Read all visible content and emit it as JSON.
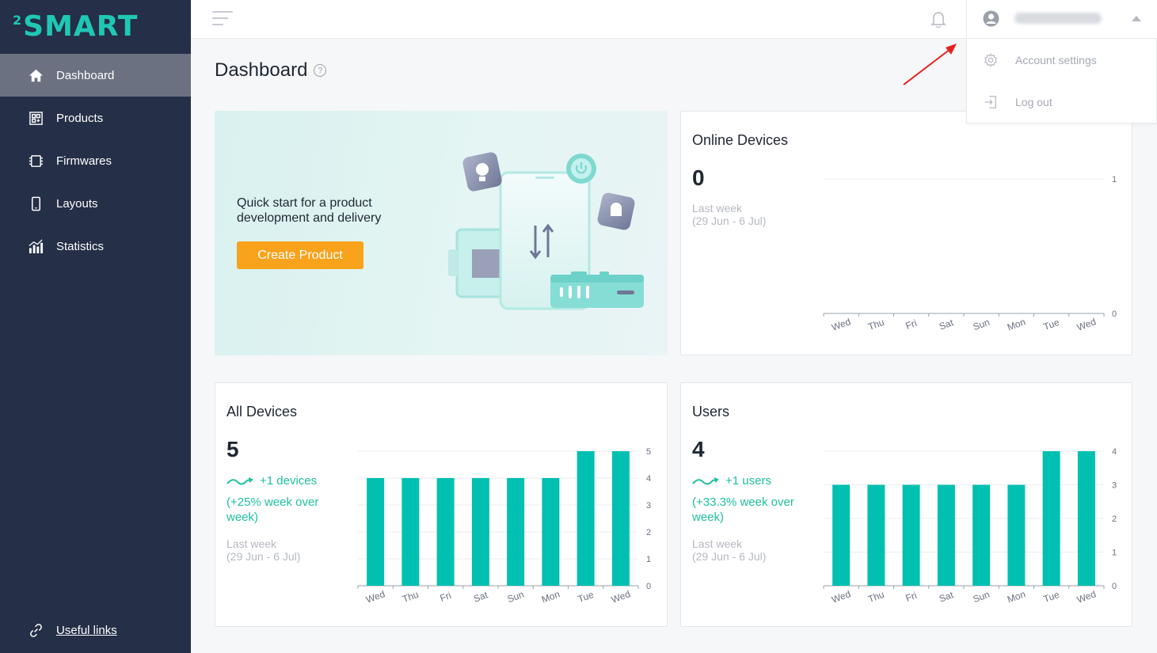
{
  "logo": {
    "sup": "2",
    "name": "SMART"
  },
  "sidebar": {
    "items": [
      {
        "label": "Dashboard",
        "icon": "home-icon",
        "active": true
      },
      {
        "label": "Products",
        "icon": "products-icon",
        "active": false
      },
      {
        "label": "Firmwares",
        "icon": "chip-icon",
        "active": false
      },
      {
        "label": "Layouts",
        "icon": "phone-icon",
        "active": false
      },
      {
        "label": "Statistics",
        "icon": "statistics-icon",
        "active": false
      }
    ],
    "useful_links": "Useful links"
  },
  "account_menu": {
    "items": [
      {
        "label": "Account settings",
        "icon": "gear-icon"
      },
      {
        "label": "Log out",
        "icon": "logout-icon"
      }
    ]
  },
  "page": {
    "title": "Dashboard",
    "help": "?"
  },
  "promo": {
    "text_line1": "Quick start for a product",
    "text_line2": "development and delivery",
    "button": "Create Product"
  },
  "cards": {
    "online": {
      "title": "Online Devices",
      "value": "0",
      "last_week": "Last week",
      "range": "(29 Jun - 6 Jul)"
    },
    "all": {
      "title": "All Devices",
      "value": "5",
      "trend": "+1 devices",
      "trend_detail_1": "(+25% week over",
      "trend_detail_2": "week)",
      "last_week": "Last week",
      "range": "(29 Jun - 6 Jul)"
    },
    "users": {
      "title": "Users",
      "value": "4",
      "trend": "+1 users",
      "trend_detail_1": "(+33.3% week over",
      "trend_detail_2": "week)",
      "last_week": "Last week",
      "range": "(29 Jun - 6 Jul)"
    }
  },
  "colors": {
    "accent": "#1fc8b4",
    "bar": "#00c0b1",
    "sidebar": "#252f47",
    "button": "#f9a21b",
    "trend": "#1fc0a0"
  },
  "chart_data": [
    {
      "type": "line",
      "categories": [
        "Wed",
        "Thu",
        "Fri",
        "Sat",
        "Sun",
        "Mon",
        "Tue",
        "Wed"
      ],
      "series": [
        {
          "values": [
            0,
            0,
            0,
            0,
            0,
            0,
            0,
            0
          ]
        }
      ],
      "ylim": [
        0,
        1
      ],
      "yticks": [
        0,
        1
      ]
    },
    {
      "type": "bar",
      "categories": [
        "Wed",
        "Thu",
        "Fri",
        "Sat",
        "Sun",
        "Mon",
        "Tue",
        "Wed"
      ],
      "values": [
        4,
        4,
        4,
        4,
        4,
        4,
        5,
        5
      ],
      "ylim": [
        0,
        5
      ],
      "yticks": [
        0,
        1,
        2,
        3,
        4,
        5
      ]
    },
    {
      "type": "bar",
      "categories": [
        "Wed",
        "Thu",
        "Fri",
        "Sat",
        "Sun",
        "Mon",
        "Tue",
        "Wed"
      ],
      "values": [
        3,
        3,
        3,
        3,
        3,
        3,
        4,
        4
      ],
      "ylim": [
        0,
        4
      ],
      "yticks": [
        0,
        1,
        2,
        3,
        4
      ]
    }
  ]
}
